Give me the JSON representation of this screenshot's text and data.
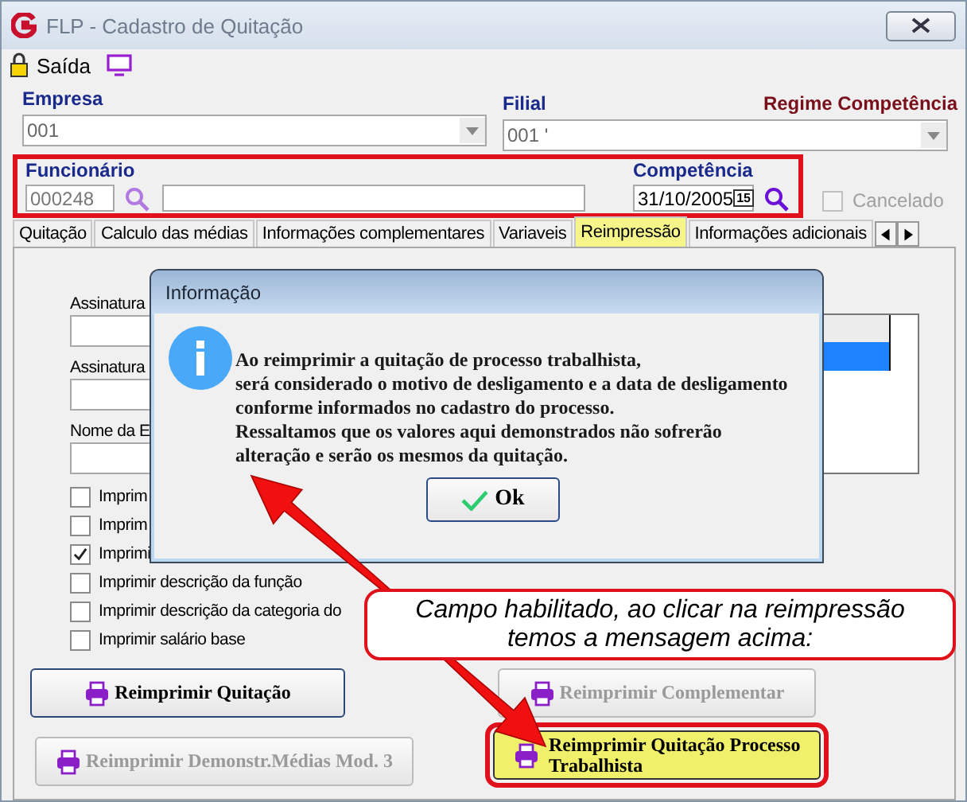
{
  "window": {
    "title": "FLP - Cadastro de Quitação"
  },
  "toolbar": {
    "exit_label": "Saída"
  },
  "header": {
    "regime": "Regime Competência",
    "empresa": {
      "label": "Empresa",
      "value": "001"
    },
    "filial": {
      "label": "Filial",
      "value": "001 '"
    },
    "employee": {
      "highlighted": true,
      "label": "Funcionário",
      "code": "000248",
      "period_label": "Competência",
      "period": "31/10/2005",
      "calendar_day": "15"
    },
    "cancelado": {
      "label": "Cancelado",
      "checked": false,
      "disabled": true
    }
  },
  "tabs": [
    {
      "label": "Quitação",
      "selected": false
    },
    {
      "label": "Calculo das médias",
      "selected": false
    },
    {
      "label": "Informações complementares",
      "selected": false
    },
    {
      "label": "Variaveis",
      "selected": false
    },
    {
      "label": "Reimpressão",
      "selected": true
    },
    {
      "label": "Informações adicionais",
      "selected": false
    }
  ],
  "panel": {
    "fields": [
      {
        "label": "Assinatura"
      },
      {
        "label": "Assinatura"
      },
      {
        "label": "Nome da E"
      }
    ],
    "list": {
      "rows": [
        {
          "selected": true
        }
      ]
    },
    "checkboxes": [
      {
        "label": "Imprim",
        "checked": false
      },
      {
        "label": "Imprim",
        "checked": false
      },
      {
        "label": "Imprimi",
        "checked": true
      },
      {
        "label": "Imprimir descrição da função",
        "checked": false
      },
      {
        "label": "Imprimir descrição da categoria do",
        "checked": false
      },
      {
        "label": "Imprimir salário base",
        "checked": false
      }
    ],
    "buttons": [
      {
        "label": "Reimprimir Quitação",
        "disabled": false,
        "focused": true,
        "highlighted": false
      },
      {
        "label": "Reimprimir Complementar",
        "disabled": true,
        "focused": false,
        "highlighted": false
      },
      {
        "label": "Reimprimir Demonstr.Médias Mod. 3",
        "disabled": true,
        "focused": false,
        "highlighted": false
      },
      {
        "label": "Reimprimir Quitação Processo Trabalhista",
        "disabled": false,
        "focused": false,
        "highlighted": true
      }
    ]
  },
  "dialog": {
    "title": "Informação",
    "lines": [
      "Ao reimprimir a quitação de processo trabalhista,",
      "será considerado o motivo de desligamento e a data de desligamento",
      "conforme informados no cadastro do processo.",
      "Ressaltamos que os valores aqui demonstrados não sofrerão",
      "alteração e serão os mesmos da quitação."
    ],
    "ok": "Ok"
  },
  "callout": {
    "lines": [
      "Campo habilitado, ao clicar na reimpressão",
      "temos a mensagem acima:"
    ]
  }
}
